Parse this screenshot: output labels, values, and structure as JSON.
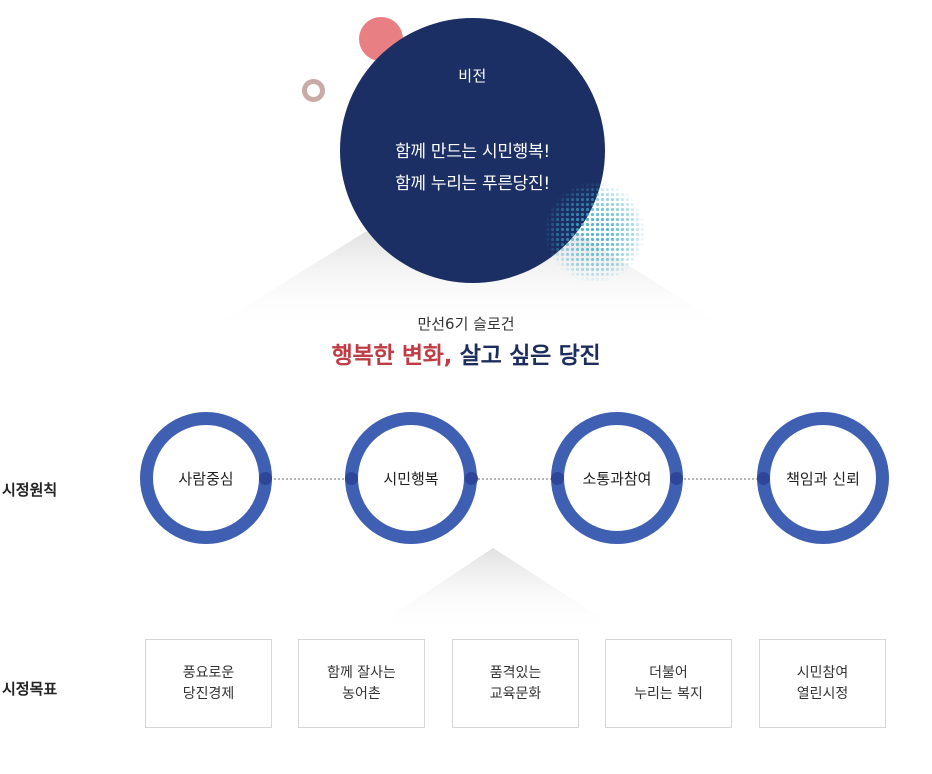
{
  "vision": {
    "label": "비전",
    "line1": "함께 만드는 시민행복!",
    "line2": "함께 누리는 푸른당진!"
  },
  "slogan": {
    "subtitle": "만선6기 슬로건",
    "highlight": "행복한 변화,",
    "rest": "살고 싶은 당진"
  },
  "principles": {
    "label": "시정원칙",
    "items": [
      "사람중심",
      "시민행복",
      "소통과참여",
      "책임과 신뢰"
    ]
  },
  "goals": {
    "label": "시정목표",
    "items": [
      {
        "line1": "풍요로운",
        "line2": "당진경제"
      },
      {
        "line1": "함께 잘사는",
        "line2": "농어촌"
      },
      {
        "line1": "품격있는",
        "line2": "교육문화"
      },
      {
        "line1": "더불어",
        "line2": "누리는 복지"
      },
      {
        "line1": "시민참여",
        "line2": "열린시정"
      }
    ]
  },
  "colors": {
    "navy": "#1b2f64",
    "ring_blue": "#3f5fb2",
    "accent_red": "#bf3c45",
    "deco_pink": "#e87f82",
    "halftone_teal": "#3fb0cf"
  }
}
